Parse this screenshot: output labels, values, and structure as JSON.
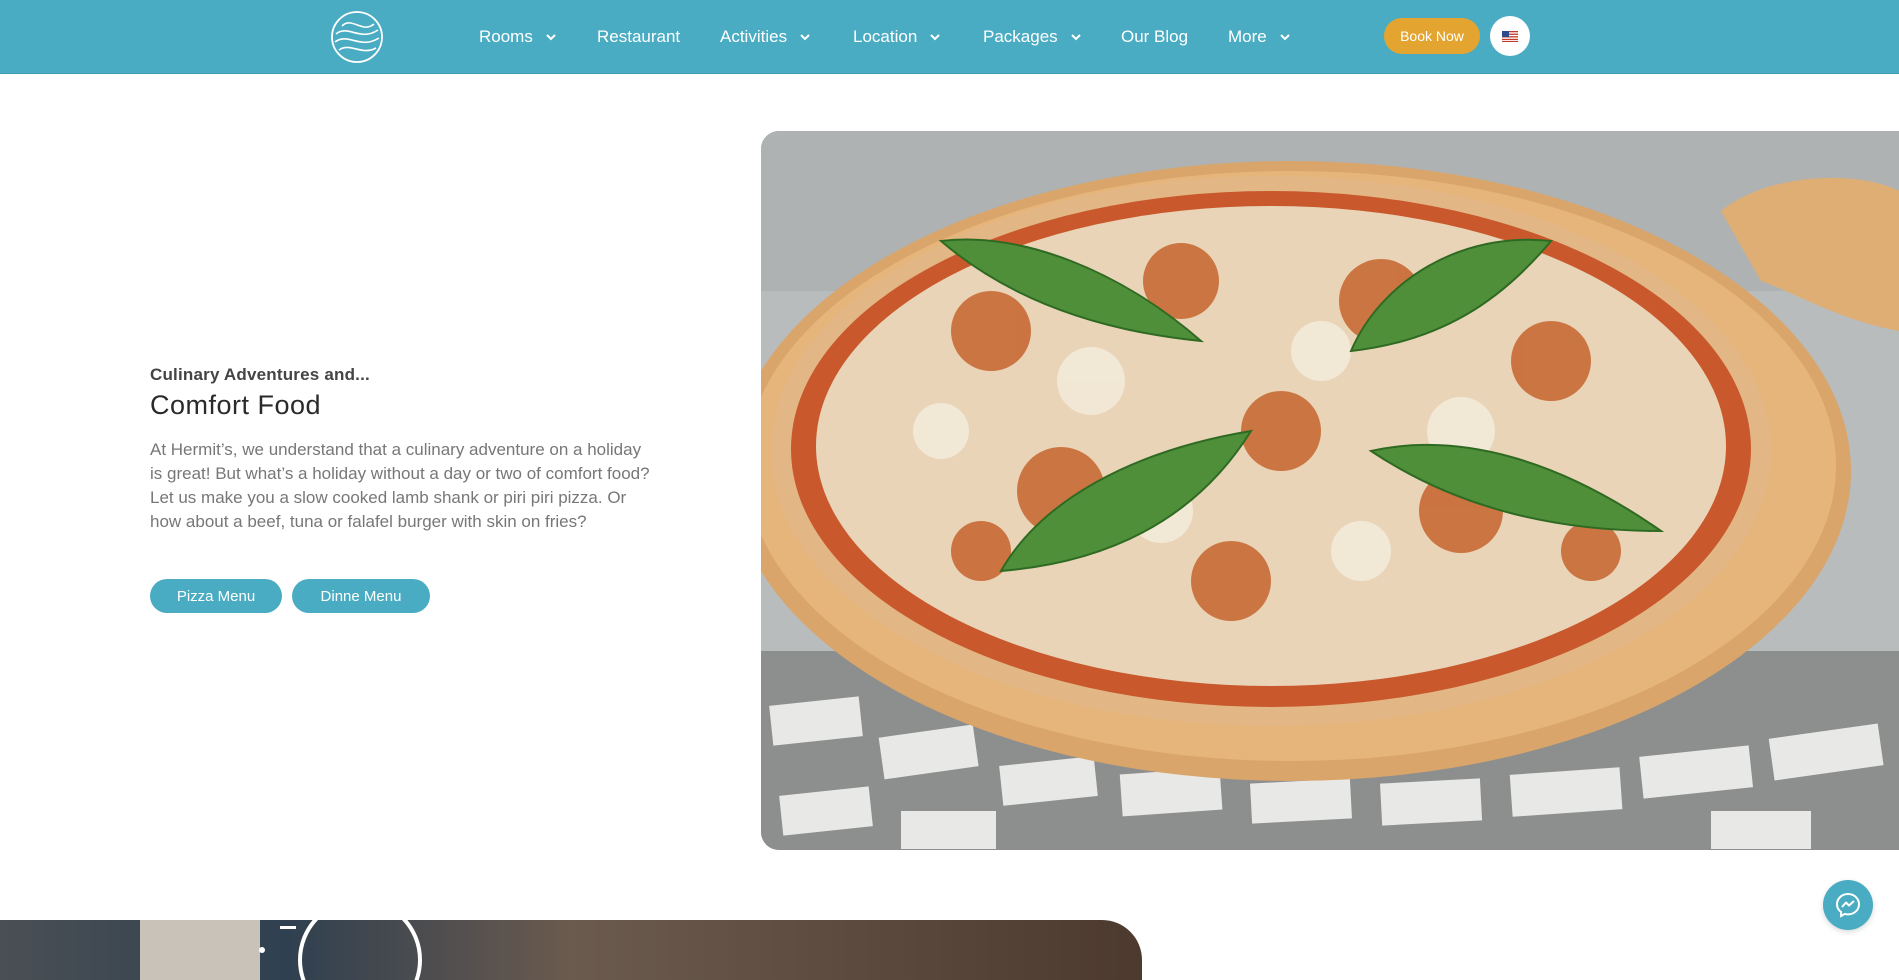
{
  "header": {
    "nav": [
      {
        "label": "Rooms",
        "has_dropdown": true
      },
      {
        "label": "Restaurant",
        "has_dropdown": false
      },
      {
        "label": "Activities",
        "has_dropdown": true
      },
      {
        "label": "Location",
        "has_dropdown": true
      },
      {
        "label": "Packages",
        "has_dropdown": true
      },
      {
        "label": "Our Blog",
        "has_dropdown": false
      },
      {
        "label": "More",
        "has_dropdown": true
      }
    ],
    "book_label": "Book Now",
    "language_icon": "us-flag-icon"
  },
  "section": {
    "eyebrow": "Culinary Adventures and...",
    "title": "Comfort Food",
    "body": "At Hermit’s, we understand that a culinary adventure on a holiday is great! But what’s a holiday without a day or two of comfort food? Let us make you a slow cooked lamb shank or piri piri pizza. Or how about a beef, tuna or falafel burger with skin on fries?",
    "buttons": [
      "Pizza Menu",
      "Dinne Menu"
    ]
  },
  "colors": {
    "header": "#4aacc2",
    "accent": "#e3a52f",
    "button": "#4aacc2"
  },
  "chat_icon": "messenger-icon"
}
